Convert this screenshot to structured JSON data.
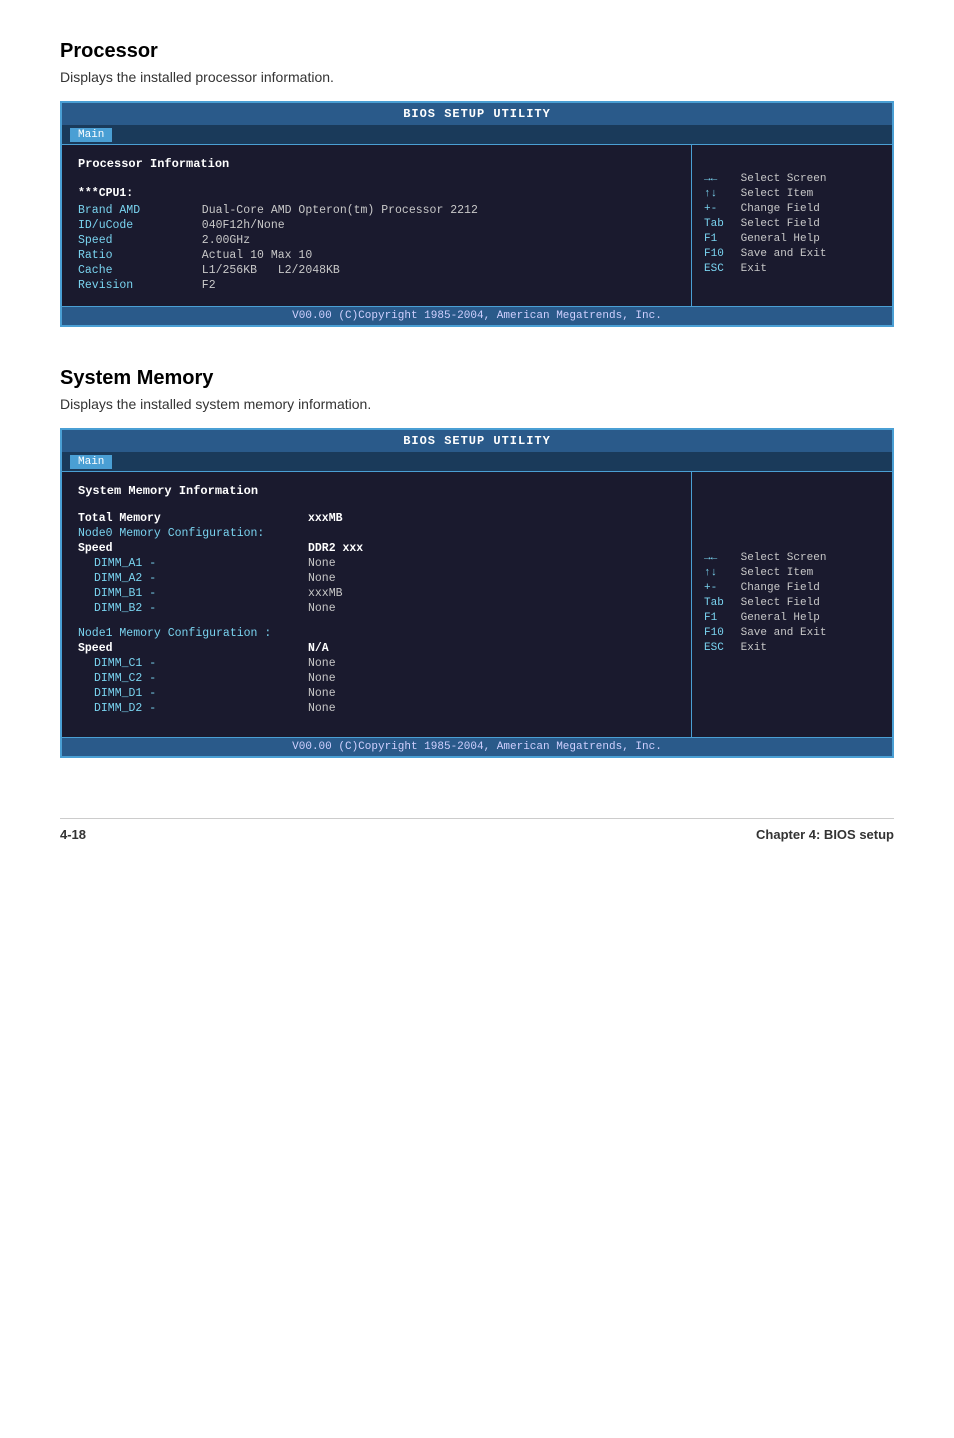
{
  "processor_section": {
    "title": "Processor",
    "description": "Displays the installed processor information.",
    "bios": {
      "header": "BIOS SETUP UTILITY",
      "tab": "Main",
      "section_label": "Processor Information",
      "cpu_heading": "***CPU1:",
      "fields": [
        {
          "label": "Brand AMD",
          "value": "Dual-Core AMD Opteron(tm) Processor 2212"
        },
        {
          "label": "ID/uCode",
          "value": "040F12h/None"
        },
        {
          "label": "Speed   ",
          "value": "2.00GHz"
        },
        {
          "label": "Ratio   ",
          "value": "Actual 10 Max 10"
        },
        {
          "label": "Cache   ",
          "value": "L1/256KB   L2/2048KB"
        },
        {
          "label": "Revision",
          "value": "F2"
        }
      ],
      "keys": [
        {
          "key": "→←",
          "desc": "Select Screen"
        },
        {
          "key": "↑↓",
          "desc": "Select Item"
        },
        {
          "key": "+-",
          "desc": "Change Field"
        },
        {
          "key": "Tab",
          "desc": "Select Field"
        },
        {
          "key": "F1",
          "desc": "General Help"
        },
        {
          "key": "F10",
          "desc": "Save and Exit"
        },
        {
          "key": "ESC",
          "desc": "Exit"
        }
      ],
      "footer": "V00.00 (C)Copyright 1985-2004, American Megatrends, Inc."
    }
  },
  "memory_section": {
    "title": "System Memory",
    "description": "Displays the installed system memory information.",
    "bios": {
      "header": "BIOS SETUP UTILITY",
      "tab": "Main",
      "section_label": "System Memory Information",
      "fields": [
        {
          "label": "Total Memory",
          "indent": false,
          "value": "xxxMB",
          "bold_label": true
        },
        {
          "label": "Node0 Memory Configuration:",
          "indent": false,
          "value": "",
          "bold_label": false
        },
        {
          "label": "Speed",
          "indent": false,
          "value": "DDR2 xxx",
          "bold_label": true
        },
        {
          "label": "  DIMM_A1   -",
          "indent": true,
          "value": "None",
          "bold_label": false
        },
        {
          "label": "  DIMM_A2   -",
          "indent": true,
          "value": "None",
          "bold_label": false
        },
        {
          "label": "  DIMM_B1   -",
          "indent": true,
          "value": "xxxMB",
          "bold_label": false
        },
        {
          "label": "  DIMM_B2   -",
          "indent": true,
          "value": "None",
          "bold_label": false
        },
        {
          "label": "",
          "indent": false,
          "value": "",
          "bold_label": false
        },
        {
          "label": "Node1 Memory Configuration :",
          "indent": false,
          "value": "",
          "bold_label": false
        },
        {
          "label": "Speed",
          "indent": false,
          "value": "N/A",
          "bold_label": true
        },
        {
          "label": "  DIMM_C1   -",
          "indent": true,
          "value": "None",
          "bold_label": false
        },
        {
          "label": "  DIMM_C2   -",
          "indent": true,
          "value": "None",
          "bold_label": false
        },
        {
          "label": "  DIMM_D1   -",
          "indent": true,
          "value": "None",
          "bold_label": false
        },
        {
          "label": "  DIMM_D2   -",
          "indent": true,
          "value": "None",
          "bold_label": false
        }
      ],
      "keys": [
        {
          "key": "→←",
          "desc": "Select Screen"
        },
        {
          "key": "↑↓",
          "desc": "Select Item"
        },
        {
          "key": "+-",
          "desc": "Change Field"
        },
        {
          "key": "Tab",
          "desc": "Select Field"
        },
        {
          "key": "F1",
          "desc": "General Help"
        },
        {
          "key": "F10",
          "desc": "Save and Exit"
        },
        {
          "key": "ESC",
          "desc": "Exit"
        }
      ],
      "footer": "V00.00 (C)Copyright 1985-2004, American Megatrends, Inc."
    }
  },
  "page_footer": {
    "page_number": "4-18",
    "chapter": "Chapter 4: BIOS setup"
  }
}
